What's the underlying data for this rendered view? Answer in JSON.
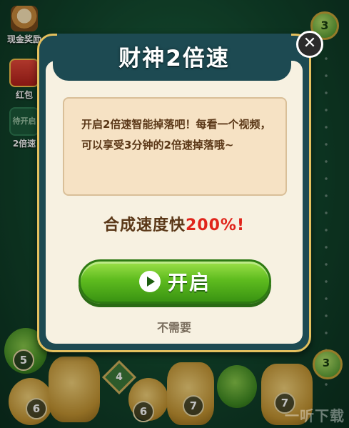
{
  "sidebar": {
    "items": [
      {
        "label": "现金奖励",
        "icon": "cash-bag-icon"
      },
      {
        "label": "红包",
        "icon": "red-envelope-icon"
      },
      {
        "label": "2倍速",
        "badge": "待开启",
        "icon": "boost-icon"
      }
    ]
  },
  "top_badge": {
    "value": "3"
  },
  "dialog": {
    "title": "财神2倍速",
    "description": "开启2倍速智能掉落吧！每看一个视频，可以享受3分钟的2倍速掉落哦~",
    "speed_prefix": "合成速度快",
    "speed_value": "200%!",
    "open_button": "开启",
    "decline": "不需要",
    "close": "✕"
  },
  "board": {
    "pieces": [
      {
        "type": "gourd",
        "level": "5"
      },
      {
        "type": "gem",
        "level": "4"
      },
      {
        "type": "bag",
        "level": "6"
      },
      {
        "type": "bag",
        "level": "6"
      },
      {
        "type": "bag",
        "level": "7"
      },
      {
        "type": "bag",
        "level": "7"
      },
      {
        "type": "coin",
        "level": "3"
      }
    ]
  },
  "watermark": "一听下载"
}
